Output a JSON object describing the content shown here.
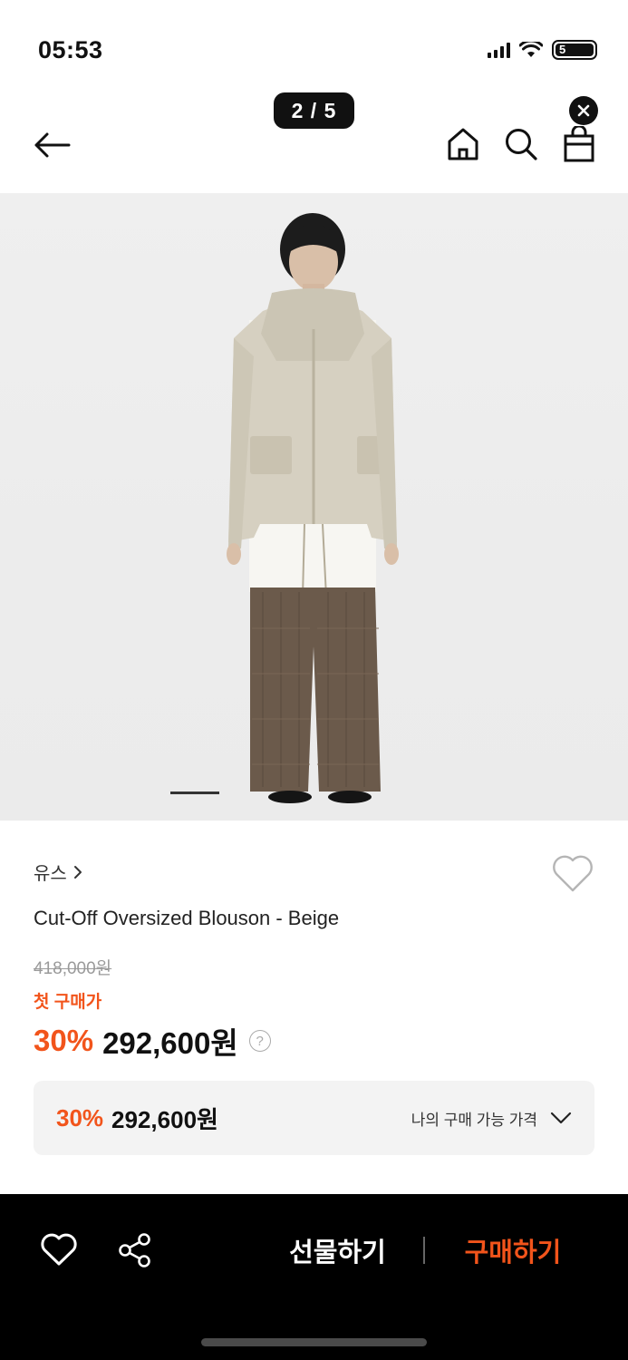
{
  "status_bar": {
    "time": "05:53",
    "battery": "5"
  },
  "gallery": {
    "counter": "2 / 5",
    "current": 2,
    "total": 5
  },
  "header": {
    "back_icon": "arrow-left-icon",
    "icons": [
      "home-icon",
      "search-icon",
      "shopping-bag-icon"
    ]
  },
  "product": {
    "brand": "유스",
    "name": "Cut-Off Oversized Blouson - Beige",
    "original_price": "418,000원",
    "first_purchase_label": "첫 구매가",
    "discount": "30%",
    "sale_price": "292,600원",
    "help": "?"
  },
  "my_price": {
    "discount": "30%",
    "price": "292,600원",
    "label": "나의 구매 가능 가격"
  },
  "bottom_bar": {
    "gift_label": "선물하기",
    "buy_label": "구매하기"
  },
  "colors": {
    "accent": "#f2541b",
    "dark": "#000000"
  }
}
